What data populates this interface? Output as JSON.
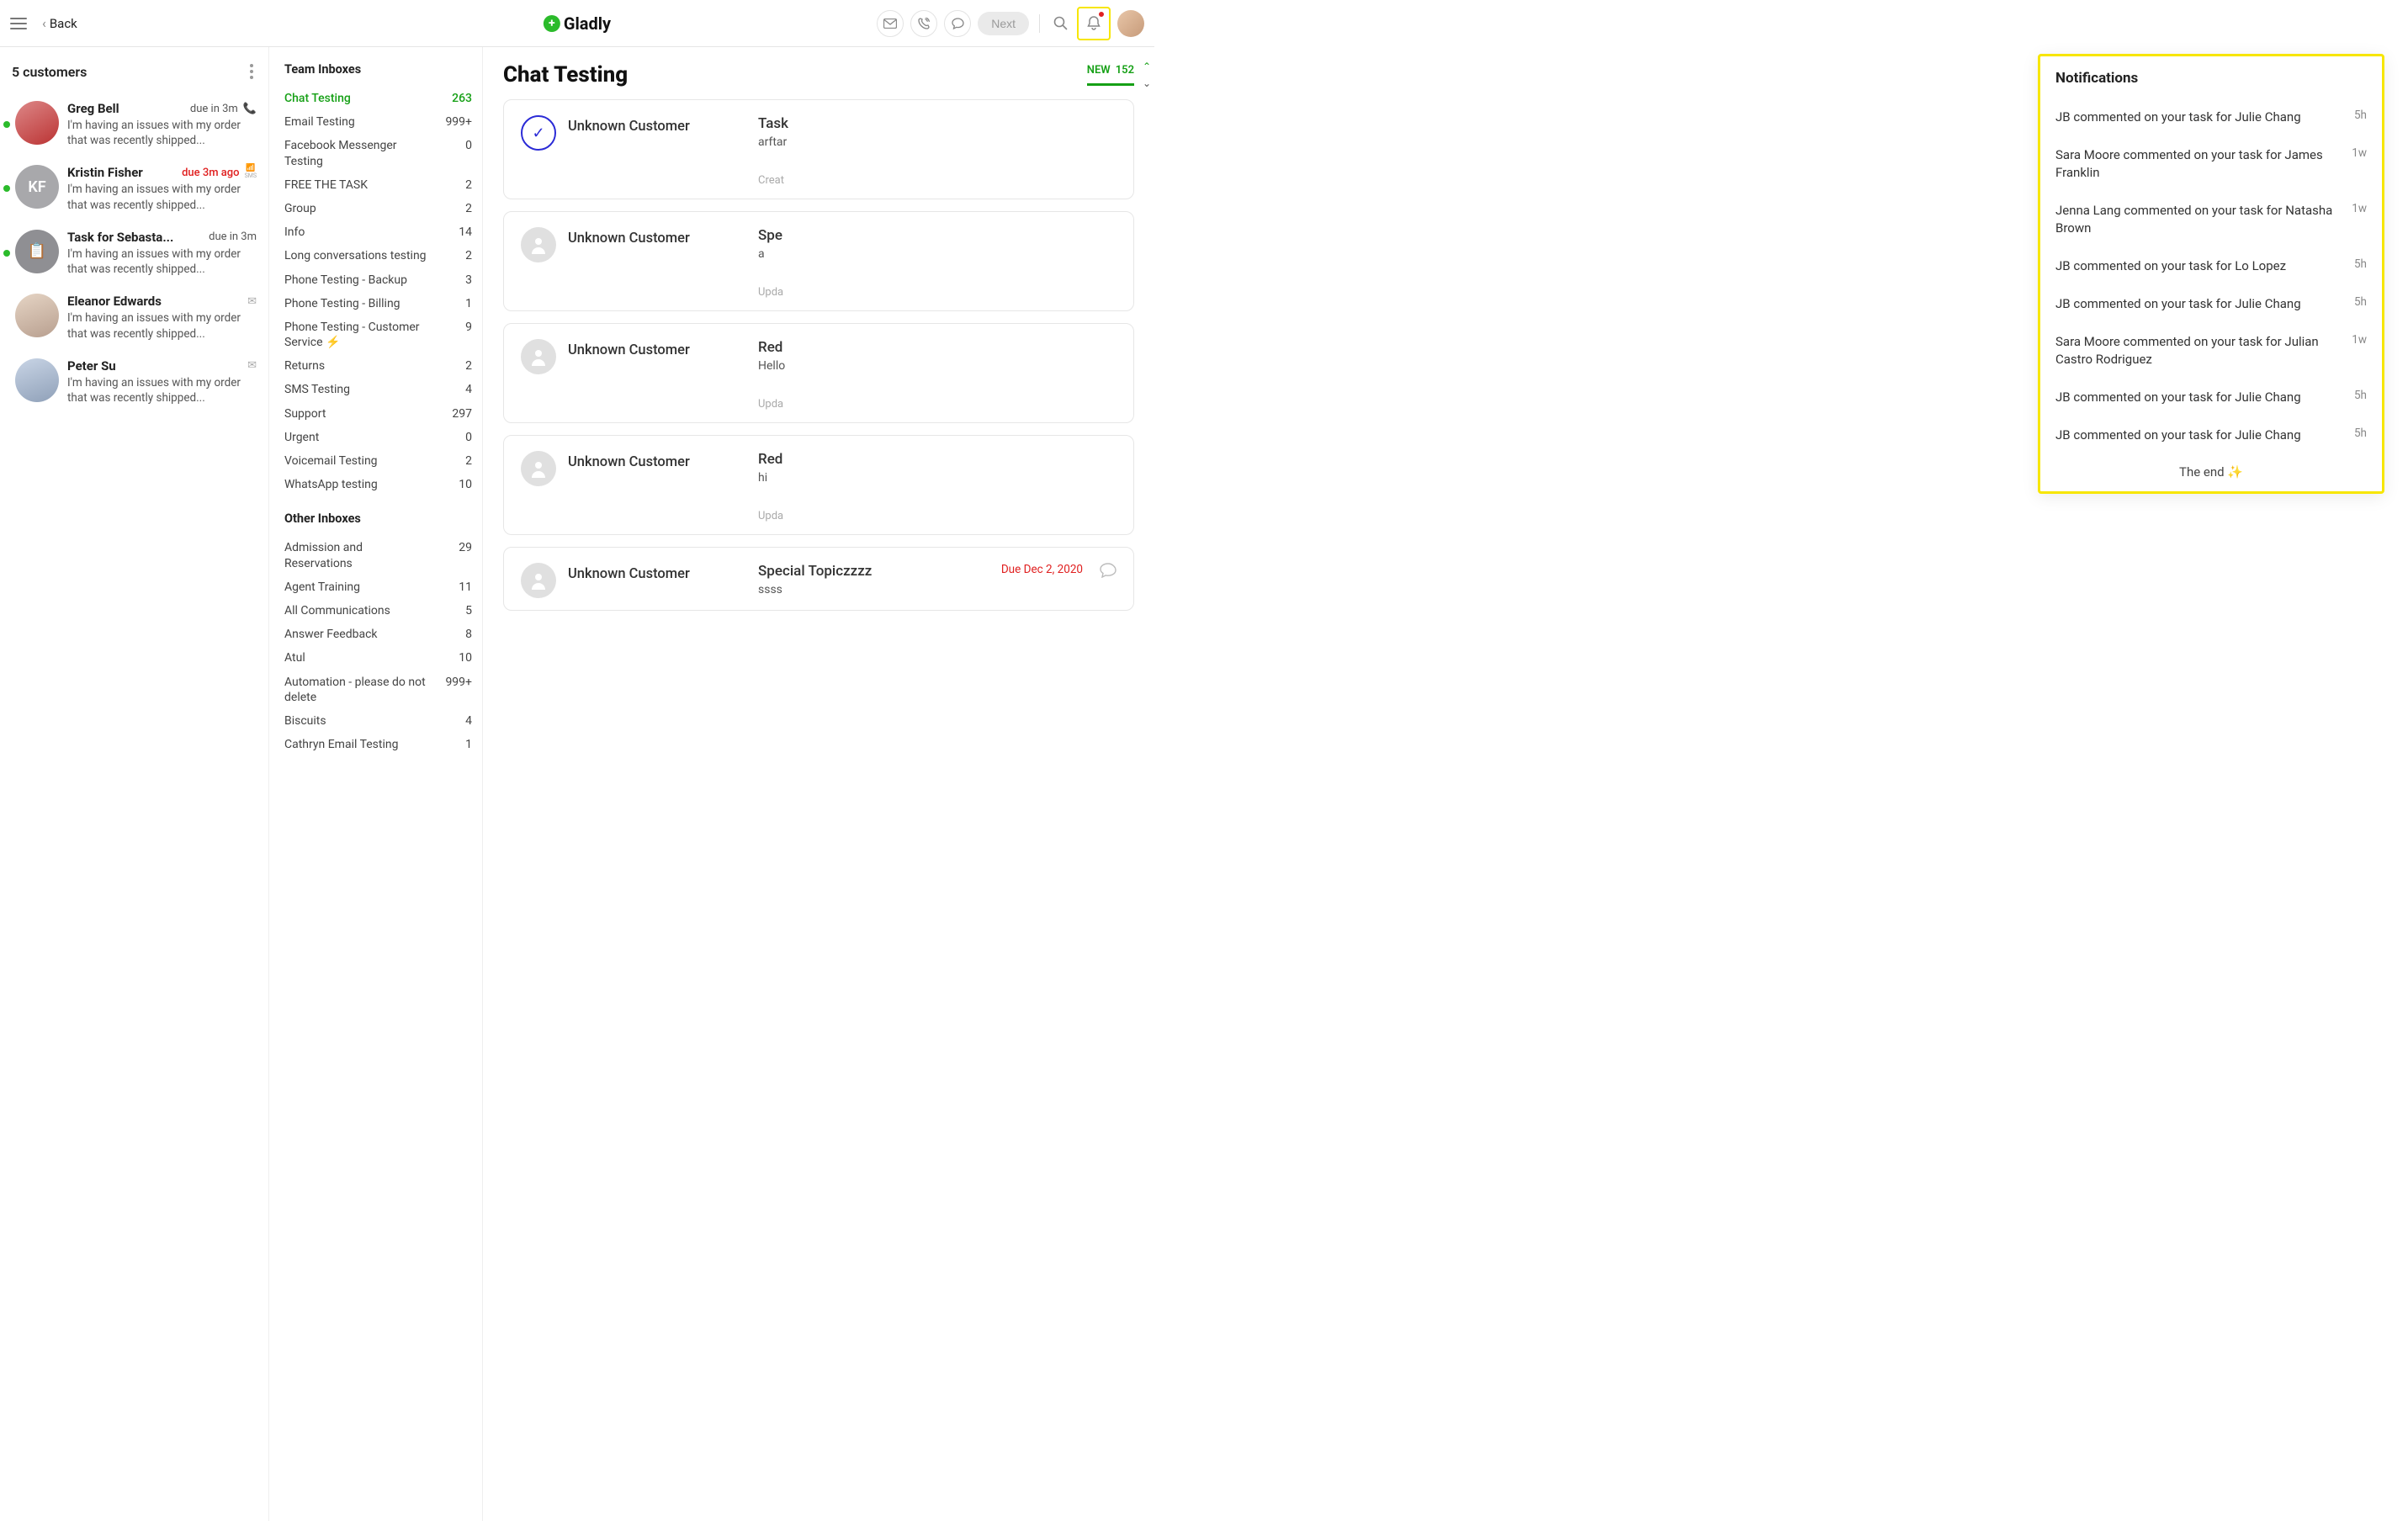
{
  "header": {
    "back_label": "Back",
    "logo_text": "Gladly",
    "next_label": "Next"
  },
  "customers": {
    "title": "5 customers",
    "items": [
      {
        "name": "Greg Bell",
        "due": "due in 3m",
        "overdue": false,
        "snippet": "I'm having an issues with my order that was recently shipped...",
        "status": true,
        "channel": "phone",
        "avatar": "av-red",
        "initials": ""
      },
      {
        "name": "Kristin Fisher",
        "due": "due 3m ago",
        "overdue": true,
        "snippet": "I'm having an issues with my order that was recently shipped...",
        "status": true,
        "channel": "sms",
        "avatar": "av-gray",
        "initials": "KF"
      },
      {
        "name": "Task for Sebasta...",
        "due": "due in 3m",
        "overdue": false,
        "snippet": "I'm having an issues with my order that was recently shipped...",
        "status": true,
        "channel": "task",
        "avatar": "av-task",
        "initials": "📋"
      },
      {
        "name": "Eleanor Edwards",
        "due": "",
        "overdue": false,
        "snippet": "I'm having an issues with my order that was recently shipped...",
        "status": false,
        "channel": "email",
        "avatar": "av-woman",
        "initials": ""
      },
      {
        "name": "Peter Su",
        "due": "",
        "overdue": false,
        "snippet": "I'm having an issues with my order that was recently shipped...",
        "status": false,
        "channel": "email",
        "avatar": "av-man",
        "initials": ""
      }
    ]
  },
  "inboxes": {
    "team_title": "Team Inboxes",
    "other_title": "Other Inboxes",
    "team": [
      {
        "name": "Chat Testing",
        "count": "263",
        "active": true
      },
      {
        "name": "Email Testing",
        "count": "999+"
      },
      {
        "name": "Facebook Messenger Testing",
        "count": "0"
      },
      {
        "name": "FREE THE TASK",
        "count": "2"
      },
      {
        "name": "Group",
        "count": "2"
      },
      {
        "name": "Info",
        "count": "14"
      },
      {
        "name": "Long conversations testing",
        "count": "2"
      },
      {
        "name": "Phone Testing - Backup",
        "count": "3"
      },
      {
        "name": "Phone Testing - Billing",
        "count": "1"
      },
      {
        "name": "Phone Testing - Customer Service ⚡",
        "count": "9"
      },
      {
        "name": "Returns",
        "count": "2"
      },
      {
        "name": "SMS Testing",
        "count": "4"
      },
      {
        "name": "Support",
        "count": "297"
      },
      {
        "name": "Urgent",
        "count": "0"
      },
      {
        "name": "Voicemail Testing",
        "count": "2"
      },
      {
        "name": "WhatsApp testing",
        "count": "10"
      }
    ],
    "other": [
      {
        "name": "Admission and Reservations",
        "count": "29"
      },
      {
        "name": "Agent Training",
        "count": "11"
      },
      {
        "name": "All Communications",
        "count": "5"
      },
      {
        "name": "Answer Feedback",
        "count": "8"
      },
      {
        "name": "Atul",
        "count": "10"
      },
      {
        "name": "Automation - please do not delete",
        "count": "999+"
      },
      {
        "name": "Biscuits",
        "count": "4"
      },
      {
        "name": "Cathryn Email Testing",
        "count": "1"
      }
    ]
  },
  "main": {
    "title": "Chat Testing",
    "tabs": [
      {
        "label": "NEW",
        "count": "152",
        "active": true
      }
    ],
    "conversations": [
      {
        "check": true,
        "customer": "Unknown Customer",
        "title": "Task",
        "sub": "arftar",
        "meta": "Creat",
        "due": ""
      },
      {
        "check": false,
        "customer": "Unknown Customer",
        "title": "Spe",
        "sub": "a",
        "meta": "Upda",
        "due": ""
      },
      {
        "check": false,
        "customer": "Unknown Customer",
        "title": "Red",
        "sub": "Hello",
        "meta": "Upda",
        "due": ""
      },
      {
        "check": false,
        "customer": "Unknown Customer",
        "title": "Red",
        "sub": "hi",
        "meta": "Upda",
        "due": ""
      },
      {
        "check": false,
        "customer": "Unknown Customer",
        "title": "Special Topiczzzz",
        "sub": "ssss",
        "meta": "",
        "due": "Due Dec 2, 2020"
      }
    ]
  },
  "notifications": {
    "title": "Notifications",
    "end_text": "The end ✨",
    "items": [
      {
        "text": "JB commented on your task for Julie Chang",
        "time": "5h"
      },
      {
        "text": "Sara Moore commented on your task for James Franklin",
        "time": "1w"
      },
      {
        "text": "Jenna Lang commented on your task for Natasha Brown",
        "time": "1w"
      },
      {
        "text": "JB commented on your task for Lo Lopez",
        "time": "5h"
      },
      {
        "text": "JB commented on your task for Julie Chang",
        "time": "5h"
      },
      {
        "text": "Sara Moore commented on your task for Julian Castro Rodriguez",
        "time": "1w"
      },
      {
        "text": "JB commented on your task for Julie Chang",
        "time": "5h"
      },
      {
        "text": "JB commented on your task for Julie Chang",
        "time": "5h"
      }
    ]
  }
}
